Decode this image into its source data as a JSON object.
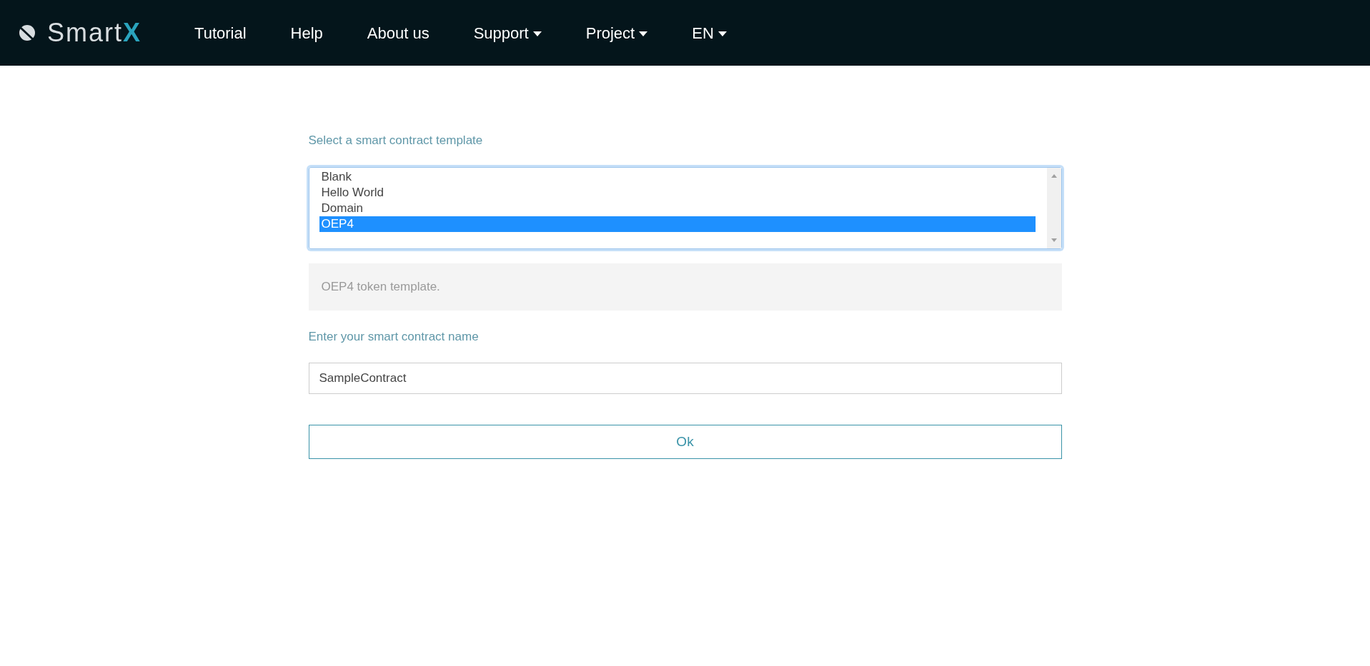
{
  "navbar": {
    "brand": {
      "text": "Smart",
      "accent": "X"
    },
    "items": [
      {
        "label": "Tutorial",
        "dropdown": false
      },
      {
        "label": "Help",
        "dropdown": false
      },
      {
        "label": "About us",
        "dropdown": false
      },
      {
        "label": "Support",
        "dropdown": true
      },
      {
        "label": "Project",
        "dropdown": true
      },
      {
        "label": "EN",
        "dropdown": true
      }
    ]
  },
  "form": {
    "template_label": "Select a smart contract template",
    "templates": [
      {
        "label": "Blank",
        "selected": false
      },
      {
        "label": "Hello World",
        "selected": false
      },
      {
        "label": "Domain",
        "selected": false
      },
      {
        "label": "OEP4",
        "selected": true
      }
    ],
    "description": "OEP4 token template.",
    "name_label": "Enter your smart contract name",
    "name_value": "SampleContract",
    "button": "Ok"
  }
}
